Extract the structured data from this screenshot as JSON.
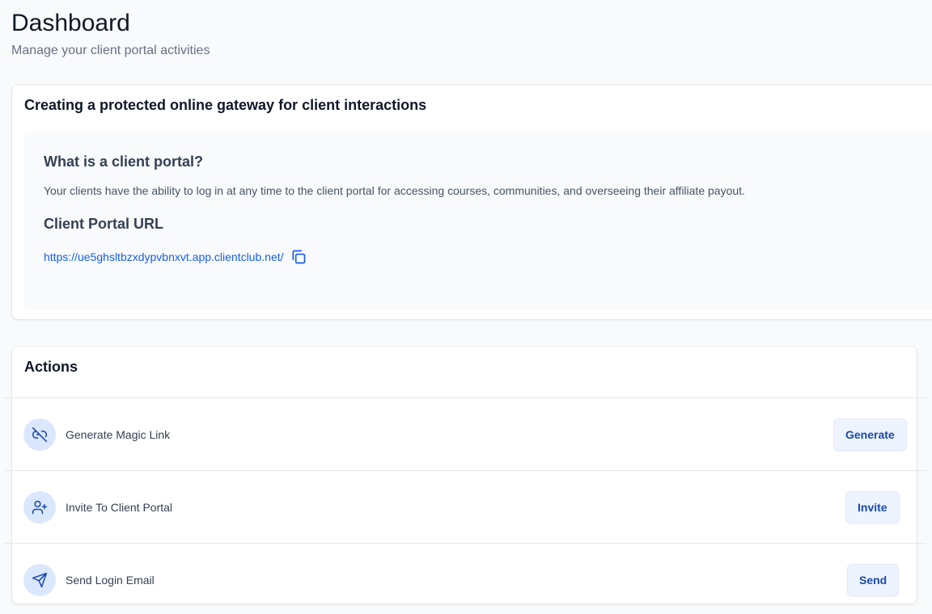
{
  "header": {
    "title": "Dashboard",
    "subtitle": "Manage your client portal activities"
  },
  "info_card": {
    "title": "Creating a protected online gateway for client interactions",
    "question": "What is a client portal?",
    "description": "Your clients have the ability to log in at any time to the client portal for accessing courses, communities, and overseeing their affiliate payout.",
    "url_title": "Client Portal URL",
    "url": "https://ue5ghsltbzxdypvbnxvt.app.clientclub.net/",
    "copy_icon": "copy-icon"
  },
  "actions": {
    "title": "Actions",
    "items": [
      {
        "label": "Generate Magic Link",
        "button": "Generate",
        "icon": "link-broken-icon"
      },
      {
        "label": "Invite To Client Portal",
        "button": "Invite",
        "icon": "user-plus-icon"
      },
      {
        "label": "Send Login Email",
        "button": "Send",
        "icon": "send-icon"
      }
    ]
  },
  "colors": {
    "accent": "#155eef",
    "button_text": "#1849a9",
    "button_bg": "#eef4ff",
    "icon_circle": "#dbe7fd"
  }
}
